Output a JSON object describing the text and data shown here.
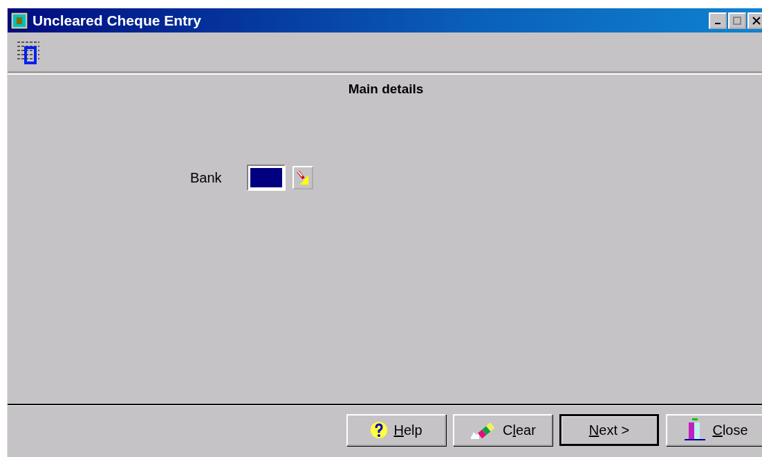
{
  "window": {
    "title": "Uncleared Cheque Entry"
  },
  "section": {
    "title": "Main details"
  },
  "fields": [
    {
      "label": "Bank",
      "focused": true
    }
  ],
  "buttons": [
    {
      "kind": "help",
      "hotkey": "H",
      "after": "elp",
      "default": false
    },
    {
      "kind": "clear",
      "before": "C",
      "hotkey": "l",
      "after": "ear",
      "default": false
    },
    {
      "kind": "next",
      "hotkey": "N",
      "after": "ext >",
      "default": true
    },
    {
      "kind": "close",
      "hotkey": "C",
      "after": "lose",
      "default": false
    }
  ]
}
